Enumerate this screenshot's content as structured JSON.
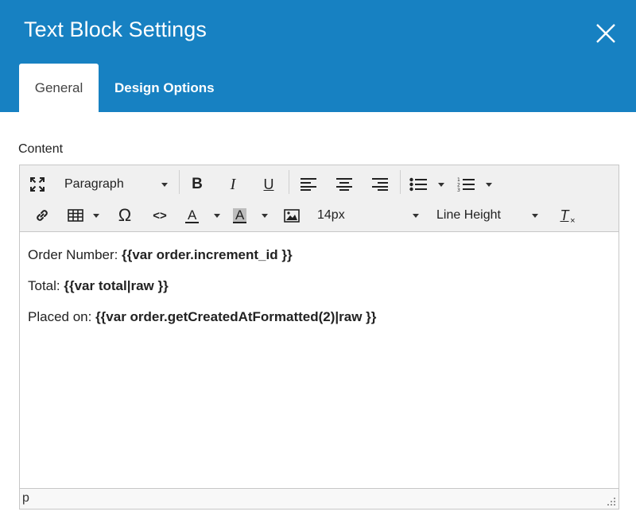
{
  "dialog": {
    "title": "Text Block Settings",
    "close_icon": "close-icon"
  },
  "tabs": [
    {
      "label": "General",
      "active": true
    },
    {
      "label": "Design Options",
      "active": false
    }
  ],
  "content_label": "Content",
  "toolbar": {
    "row1": {
      "fullscreen_icon": "fullscreen-icon",
      "format_select": "Paragraph",
      "bold": "B",
      "italic": "I",
      "underline": "U",
      "align_left_icon": "align-left-icon",
      "align_center_icon": "align-center-icon",
      "align_right_icon": "align-right-icon",
      "bullet_list_icon": "bullet-list-icon",
      "numbered_list_icon": "numbered-list-icon"
    },
    "row2": {
      "link_icon": "link-icon",
      "table_icon": "table-icon",
      "special_char": "Ω",
      "source_code": "<>",
      "text_color": "A",
      "bg_color": "A",
      "image_icon": "image-icon",
      "font_size": "14px",
      "line_height": "Line Height",
      "clear_format": "T"
    }
  },
  "editor": {
    "lines": [
      {
        "label": "Order Number: ",
        "value": "{{var order.increment_id }}"
      },
      {
        "label": "Total: ",
        "value": "{{var total|raw }}"
      },
      {
        "label": "Placed on: ",
        "value": "{{var order.getCreatedAtFormatted(2)|raw }}"
      }
    ],
    "path": "p"
  },
  "colors": {
    "header": "#1781c2",
    "toolbar_bg": "#f0f0f0"
  }
}
